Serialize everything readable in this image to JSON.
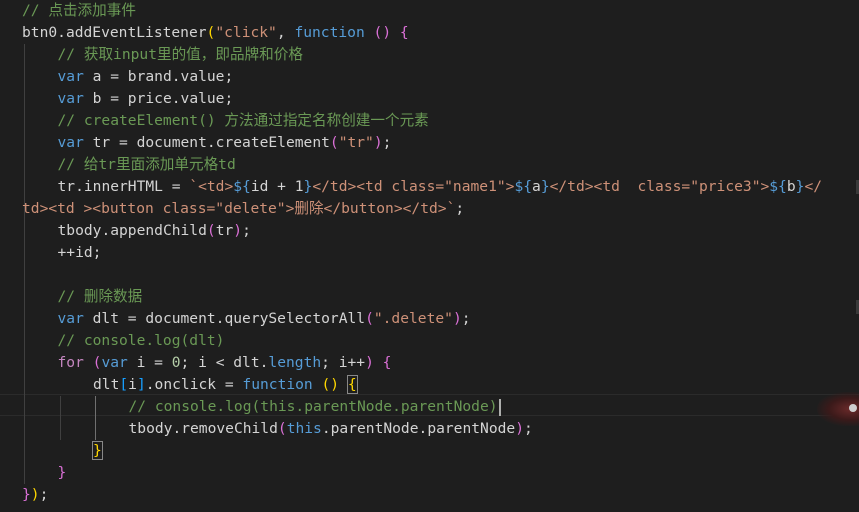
{
  "editor": {
    "lines": [
      {
        "indent": 0,
        "tokens": [
          {
            "t": "// 点击添加事件",
            "c": "com"
          }
        ]
      },
      {
        "indent": 0,
        "tokens": [
          {
            "t": "btn0",
            "c": "plain"
          },
          {
            "t": ".",
            "c": "plain"
          },
          {
            "t": "addEventListener",
            "c": "plain"
          },
          {
            "t": "(",
            "c": "yb"
          },
          {
            "t": "\"click\"",
            "c": "str"
          },
          {
            "t": ", ",
            "c": "plain"
          },
          {
            "t": "function",
            "c": "kw"
          },
          {
            "t": " ",
            "c": "plain"
          },
          {
            "t": "()",
            "c": "pb"
          },
          {
            "t": " ",
            "c": "plain"
          },
          {
            "t": "{",
            "c": "pb"
          }
        ]
      },
      {
        "indent": 1,
        "tokens": [
          {
            "t": "// 获取input里的值，即品牌和价格",
            "c": "com"
          }
        ]
      },
      {
        "indent": 1,
        "tokens": [
          {
            "t": "var",
            "c": "kw"
          },
          {
            "t": " a = ",
            "c": "plain"
          },
          {
            "t": "brand",
            "c": "plain"
          },
          {
            "t": ".",
            "c": "plain"
          },
          {
            "t": "value",
            "c": "plain"
          },
          {
            "t": ";",
            "c": "plain"
          }
        ]
      },
      {
        "indent": 1,
        "tokens": [
          {
            "t": "var",
            "c": "kw"
          },
          {
            "t": " b = ",
            "c": "plain"
          },
          {
            "t": "price",
            "c": "plain"
          },
          {
            "t": ".",
            "c": "plain"
          },
          {
            "t": "value",
            "c": "plain"
          },
          {
            "t": ";",
            "c": "plain"
          }
        ]
      },
      {
        "indent": 1,
        "tokens": [
          {
            "t": "// createElement() 方法通过指定名称创建一个元素",
            "c": "com"
          }
        ]
      },
      {
        "indent": 1,
        "tokens": [
          {
            "t": "var",
            "c": "kw"
          },
          {
            "t": " tr = ",
            "c": "plain"
          },
          {
            "t": "document",
            "c": "plain"
          },
          {
            "t": ".",
            "c": "plain"
          },
          {
            "t": "createElement",
            "c": "plain"
          },
          {
            "t": "(",
            "c": "pb"
          },
          {
            "t": "\"tr\"",
            "c": "str"
          },
          {
            "t": ")",
            "c": "pb"
          },
          {
            "t": ";",
            "c": "plain"
          }
        ]
      },
      {
        "indent": 1,
        "tokens": [
          {
            "t": "// 给tr里面添加单元格td",
            "c": "com"
          }
        ]
      },
      {
        "indent": 1,
        "tokens": [
          {
            "t": "tr",
            "c": "plain"
          },
          {
            "t": ".",
            "c": "plain"
          },
          {
            "t": "innerHTML",
            "c": "plain"
          },
          {
            "t": " = ",
            "c": "plain"
          },
          {
            "t": "`<td>",
            "c": "str"
          },
          {
            "t": "${",
            "c": "kw"
          },
          {
            "t": "id + 1",
            "c": "plain"
          },
          {
            "t": "}",
            "c": "kw"
          },
          {
            "t": "</td><td class=\"name1\">",
            "c": "str"
          },
          {
            "t": "${",
            "c": "kw"
          },
          {
            "t": "a",
            "c": "plain"
          },
          {
            "t": "}",
            "c": "kw"
          },
          {
            "t": "</td><td  class=\"price3\">",
            "c": "str"
          },
          {
            "t": "${",
            "c": "kw"
          },
          {
            "t": "b",
            "c": "plain"
          },
          {
            "t": "}",
            "c": "kw"
          },
          {
            "t": "</",
            "c": "str"
          }
        ]
      },
      {
        "indent": 0,
        "tokens": [
          {
            "t": "td><td ><button class=\"delete\">删除</button></td>`",
            "c": "str"
          },
          {
            "t": ";",
            "c": "plain"
          }
        ]
      },
      {
        "indent": 1,
        "tokens": [
          {
            "t": "tbody",
            "c": "plain"
          },
          {
            "t": ".",
            "c": "plain"
          },
          {
            "t": "appendChild",
            "c": "plain"
          },
          {
            "t": "(",
            "c": "pb"
          },
          {
            "t": "tr",
            "c": "plain"
          },
          {
            "t": ")",
            "c": "pb"
          },
          {
            "t": ";",
            "c": "plain"
          }
        ]
      },
      {
        "indent": 1,
        "tokens": [
          {
            "t": "++id",
            "c": "plain"
          },
          {
            "t": ";",
            "c": "plain"
          }
        ]
      },
      {
        "indent": 0,
        "tokens": []
      },
      {
        "indent": 1,
        "tokens": [
          {
            "t": "// 删除数据",
            "c": "com"
          }
        ]
      },
      {
        "indent": 1,
        "tokens": [
          {
            "t": "var",
            "c": "kw"
          },
          {
            "t": " dlt = ",
            "c": "plain"
          },
          {
            "t": "document",
            "c": "plain"
          },
          {
            "t": ".",
            "c": "plain"
          },
          {
            "t": "querySelectorAll",
            "c": "plain"
          },
          {
            "t": "(",
            "c": "pb"
          },
          {
            "t": "\".delete\"",
            "c": "str"
          },
          {
            "t": ")",
            "c": "pb"
          },
          {
            "t": ";",
            "c": "plain"
          }
        ]
      },
      {
        "indent": 1,
        "tokens": [
          {
            "t": "// console.log(dlt)",
            "c": "com"
          }
        ]
      },
      {
        "indent": 1,
        "tokens": [
          {
            "t": "for",
            "c": "ctl"
          },
          {
            "t": " ",
            "c": "plain"
          },
          {
            "t": "(",
            "c": "pb"
          },
          {
            "t": "var",
            "c": "kw"
          },
          {
            "t": " i = ",
            "c": "plain"
          },
          {
            "t": "0",
            "c": "num"
          },
          {
            "t": "; i < dlt",
            "c": "plain"
          },
          {
            "t": ".",
            "c": "plain"
          },
          {
            "t": "length",
            "c": "kw"
          },
          {
            "t": "; i++",
            "c": "plain"
          },
          {
            "t": ")",
            "c": "pb"
          },
          {
            "t": " ",
            "c": "plain"
          },
          {
            "t": "{",
            "c": "pb"
          }
        ]
      },
      {
        "indent": 2,
        "tokens": [
          {
            "t": "dlt",
            "c": "plain"
          },
          {
            "t": "[",
            "c": "bb"
          },
          {
            "t": "i",
            "c": "plain"
          },
          {
            "t": "]",
            "c": "bb"
          },
          {
            "t": ".",
            "c": "plain"
          },
          {
            "t": "onclick",
            "c": "plain"
          },
          {
            "t": " = ",
            "c": "plain"
          },
          {
            "t": "function",
            "c": "kw"
          },
          {
            "t": " ",
            "c": "plain"
          },
          {
            "t": "()",
            "c": "yb"
          },
          {
            "t": " ",
            "c": "plain"
          },
          {
            "t": "{",
            "c": "yb",
            "box": true
          }
        ]
      },
      {
        "indent": 3,
        "cursor": true,
        "tokens": [
          {
            "t": "// console.log(this.parentNode.parentNode)",
            "c": "com"
          }
        ]
      },
      {
        "indent": 3,
        "tokens": [
          {
            "t": "tbody",
            "c": "plain"
          },
          {
            "t": ".",
            "c": "plain"
          },
          {
            "t": "removeChild",
            "c": "plain"
          },
          {
            "t": "(",
            "c": "pb"
          },
          {
            "t": "this",
            "c": "kw"
          },
          {
            "t": ".",
            "c": "plain"
          },
          {
            "t": "parentNode",
            "c": "plain"
          },
          {
            "t": ".",
            "c": "plain"
          },
          {
            "t": "parentNode",
            "c": "plain"
          },
          {
            "t": ")",
            "c": "pb"
          },
          {
            "t": ";",
            "c": "plain"
          }
        ]
      },
      {
        "indent": 2,
        "tokens": [
          {
            "t": "}",
            "c": "yb",
            "box": true
          }
        ]
      },
      {
        "indent": 1,
        "tokens": [
          {
            "t": "}",
            "c": "pb"
          }
        ]
      },
      {
        "indent": 0,
        "tokens": [
          {
            "t": "}",
            "c": "pb"
          },
          {
            "t": ")",
            "c": "yb"
          },
          {
            "t": ";",
            "c": "plain"
          }
        ]
      }
    ]
  },
  "colors": {
    "background": "#1e1e1e",
    "comment": "#6a9955",
    "keyword": "#569cd6",
    "string": "#ce9178",
    "text": "#d4d4d4"
  }
}
